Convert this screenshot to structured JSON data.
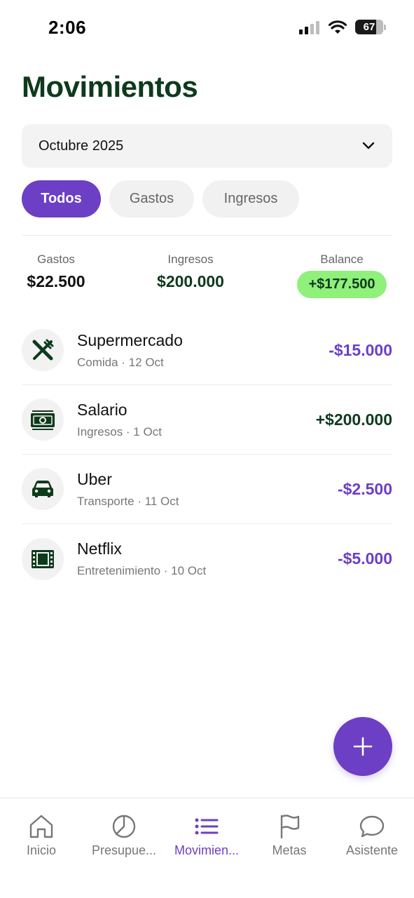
{
  "status_bar": {
    "time": "2:06",
    "battery": "67"
  },
  "title": "Movimientos",
  "month_selector": {
    "value": "Octubre 2025"
  },
  "filters": [
    {
      "label": "Todos",
      "active": true
    },
    {
      "label": "Gastos",
      "active": false
    },
    {
      "label": "Ingresos",
      "active": false
    }
  ],
  "summary": {
    "gastos_label": "Gastos",
    "gastos_value": "$22.500",
    "ingresos_label": "Ingresos",
    "ingresos_value": "$200.000",
    "balance_label": "Balance",
    "balance_value": "+$177.500"
  },
  "transactions": [
    {
      "name": "Supermercado",
      "meta": "Comida · 12 Oct",
      "amount": "-$15.000",
      "icon": "utensils-icon"
    },
    {
      "name": "Salario",
      "meta": "Ingresos · 1 Oct",
      "amount": "+$200.000",
      "icon": "money-icon"
    },
    {
      "name": "Uber",
      "meta": "Transporte · 11 Oct",
      "amount": "-$2.500",
      "icon": "car-icon"
    },
    {
      "name": "Netflix",
      "meta": "Entretenimiento · 10 Oct",
      "amount": "-$5.000",
      "icon": "film-icon"
    }
  ],
  "tabs": [
    {
      "label": "Inicio",
      "icon": "home-icon"
    },
    {
      "label": "Presupue...",
      "icon": "pie-chart-icon"
    },
    {
      "label": "Movimien...",
      "icon": "list-icon",
      "active": true
    },
    {
      "label": "Metas",
      "icon": "flag-icon"
    },
    {
      "label": "Asistente",
      "icon": "chat-icon"
    }
  ],
  "colors": {
    "primary": "#6c3fc5",
    "dark_green": "#0e3a1c",
    "balance_bg": "#8ff07a"
  }
}
